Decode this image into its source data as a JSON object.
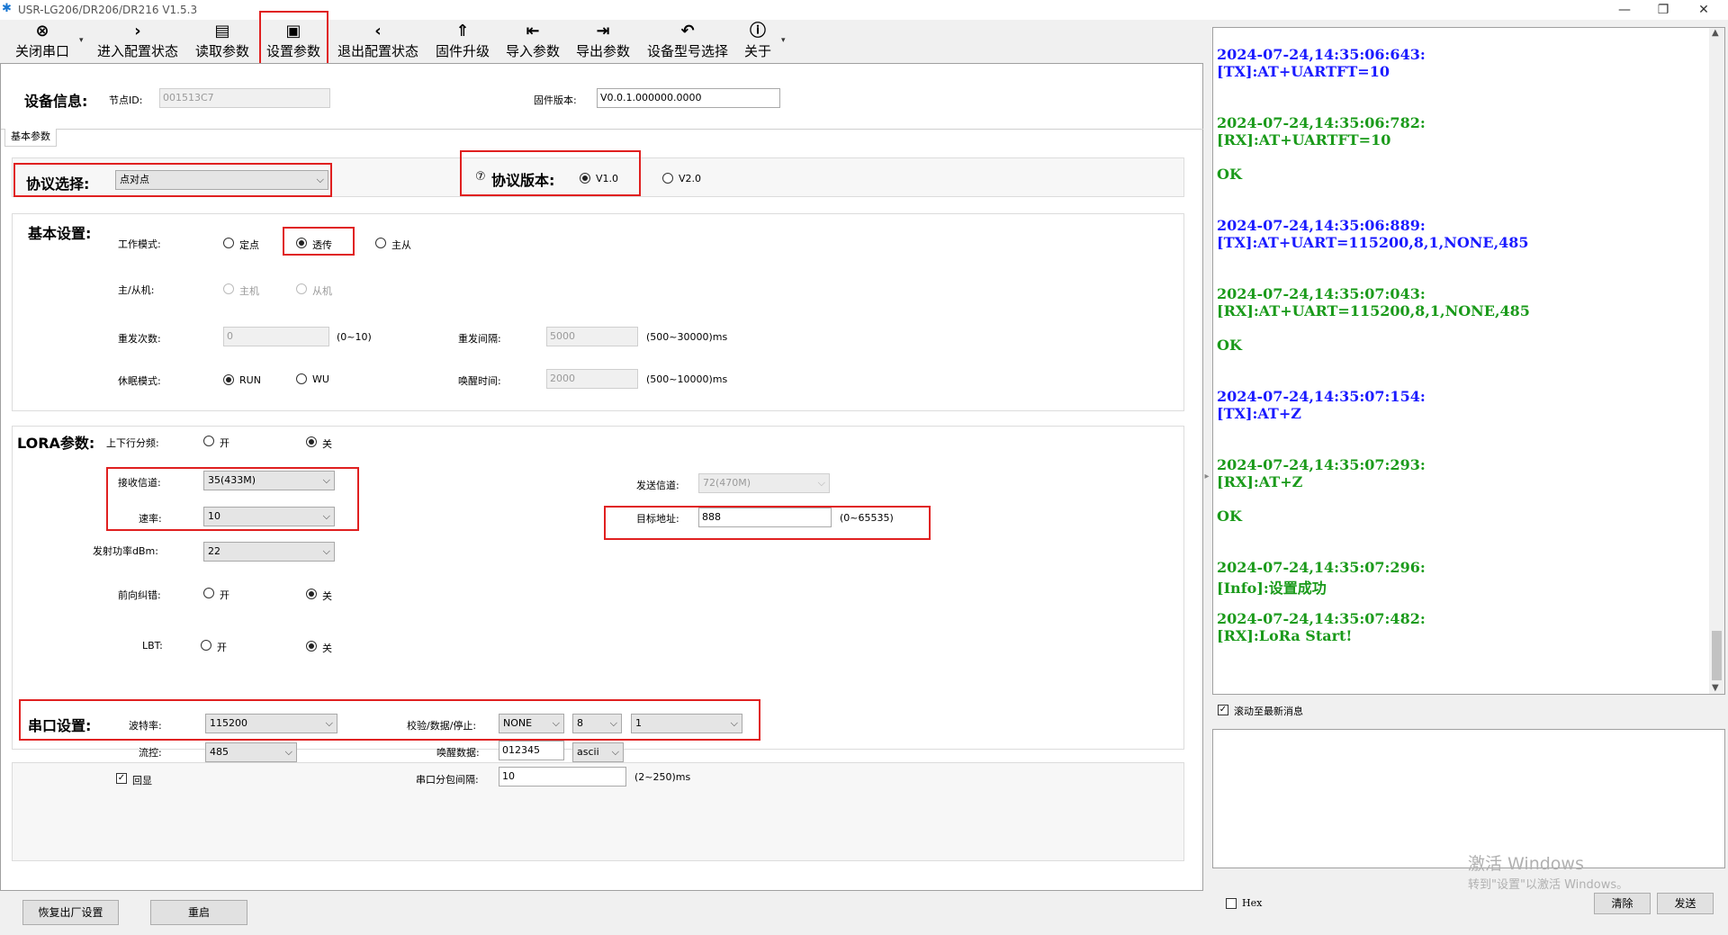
{
  "window": {
    "title": "USR-LG206/DR206/DR216 V1.5.3"
  },
  "toolbar": {
    "close_port": "关闭串口",
    "enter_config": "进入配置状态",
    "read_params": "读取参数",
    "set_params": "设置参数",
    "exit_config": "退出配置状态",
    "firmware_upgrade": "固件升级",
    "import_params": "导入参数",
    "export_params": "导出参数",
    "device_model": "设备型号选择",
    "about": "关于"
  },
  "device_info": {
    "title": "设备信息:",
    "node_id_label": "节点ID:",
    "node_id_value": "001513C7",
    "fw_label": "固件版本:",
    "fw_value": "V0.0.1.000000.0000"
  },
  "tab": {
    "label": "基本参数"
  },
  "protocol": {
    "select_label": "协议选择:",
    "select_value": "点对点",
    "version_label": "协议版本:",
    "v1": "V1.0",
    "v2": "V2.0"
  },
  "basic": {
    "title": "基本设置:",
    "work_mode_label": "工作模式:",
    "mode_fixed": "定点",
    "mode_transparent": "透传",
    "mode_master": "主从",
    "master_slave_label": "主/从机:",
    "master": "主机",
    "slave": "从机",
    "resend_count_label": "重发次数:",
    "resend_count_value": "0",
    "resend_count_range": "(0~10)",
    "resend_interval_label": "重发间隔:",
    "resend_interval_value": "5000",
    "resend_interval_range": "(500~30000)ms",
    "sleep_mode_label": "休眠模式:",
    "sleep_run": "RUN",
    "sleep_wu": "WU",
    "wake_time_label": "唤醒时间:",
    "wake_time_value": "2000",
    "wake_time_range": "(500~10000)ms"
  },
  "lora": {
    "title": "LORA参数:",
    "updown_label": "上下行分频:",
    "on": "开",
    "off": "关",
    "rx_channel_label": "接收信道:",
    "rx_channel_value": "35(433M)",
    "rate_label": "速率:",
    "rate_value": "10",
    "tx_channel_label": "发送信道:",
    "tx_channel_value": "72(470M)",
    "target_addr_label": "目标地址:",
    "target_addr_value": "888",
    "target_addr_range": "(0~65535)",
    "power_label": "发射功率dBm:",
    "power_value": "22",
    "fec_label": "前向纠错:",
    "lbt_label": "LBT:"
  },
  "serial": {
    "title": "串口设置:",
    "baud_label": "波特率:",
    "baud_value": "115200",
    "parity_label": "校验/数据/停止:",
    "parity_value": "NONE",
    "data_bits_value": "8",
    "stop_bits_value": "1",
    "flow_label": "流控:",
    "flow_value": "485",
    "wake_data_label": "唤醒数据:",
    "wake_data_value": "012345",
    "wake_data_format": "ascii",
    "echo_label": "回显",
    "packet_interval_label": "串口分包间隔:",
    "packet_interval_value": "10",
    "packet_interval_range": "(2~250)ms"
  },
  "bottom": {
    "restore": "恢复出厂设置",
    "restart": "重启"
  },
  "log": {
    "lines": [
      {
        "t": "2024-07-24,14:35:06:643:",
        "m": "[TX]:AT+UARTFT=10"
      },
      {
        "t": "2024-07-24,14:35:06:782:",
        "m": "[RX]:AT+UARTFT=10",
        "ok": "OK"
      },
      {
        "t": "2024-07-24,14:35:06:889:",
        "m": "[TX]:AT+UART=115200,8,1,NONE,485"
      },
      {
        "t": "2024-07-24,14:35:07:043:",
        "m": "[RX]:AT+UART=115200,8,1,NONE,485",
        "ok": "OK"
      },
      {
        "t": "2024-07-24,14:35:07:154:",
        "m": "[TX]:AT+Z"
      },
      {
        "t": "2024-07-24,14:35:07:293:",
        "m": "[RX]:AT+Z",
        "ok": "OK"
      },
      {
        "t": "2024-07-24,14:35:07:296:",
        "m": "[Info]:设置成功"
      },
      {
        "t": "2024-07-24,14:35:07:482:",
        "m": "[RX]:LoRa Start!"
      }
    ],
    "autoscroll_label": "滚动至最新消息",
    "hex_label": "Hex",
    "clear_label": "清除",
    "send_label": "发送"
  },
  "watermark": {
    "line1": "激活 Windows",
    "line2": "转到\"设置\"以激活 Windows。"
  },
  "colors": {
    "tx": "#1a1aff",
    "rx": "#1a9a1a",
    "highlight": "#e02020"
  }
}
